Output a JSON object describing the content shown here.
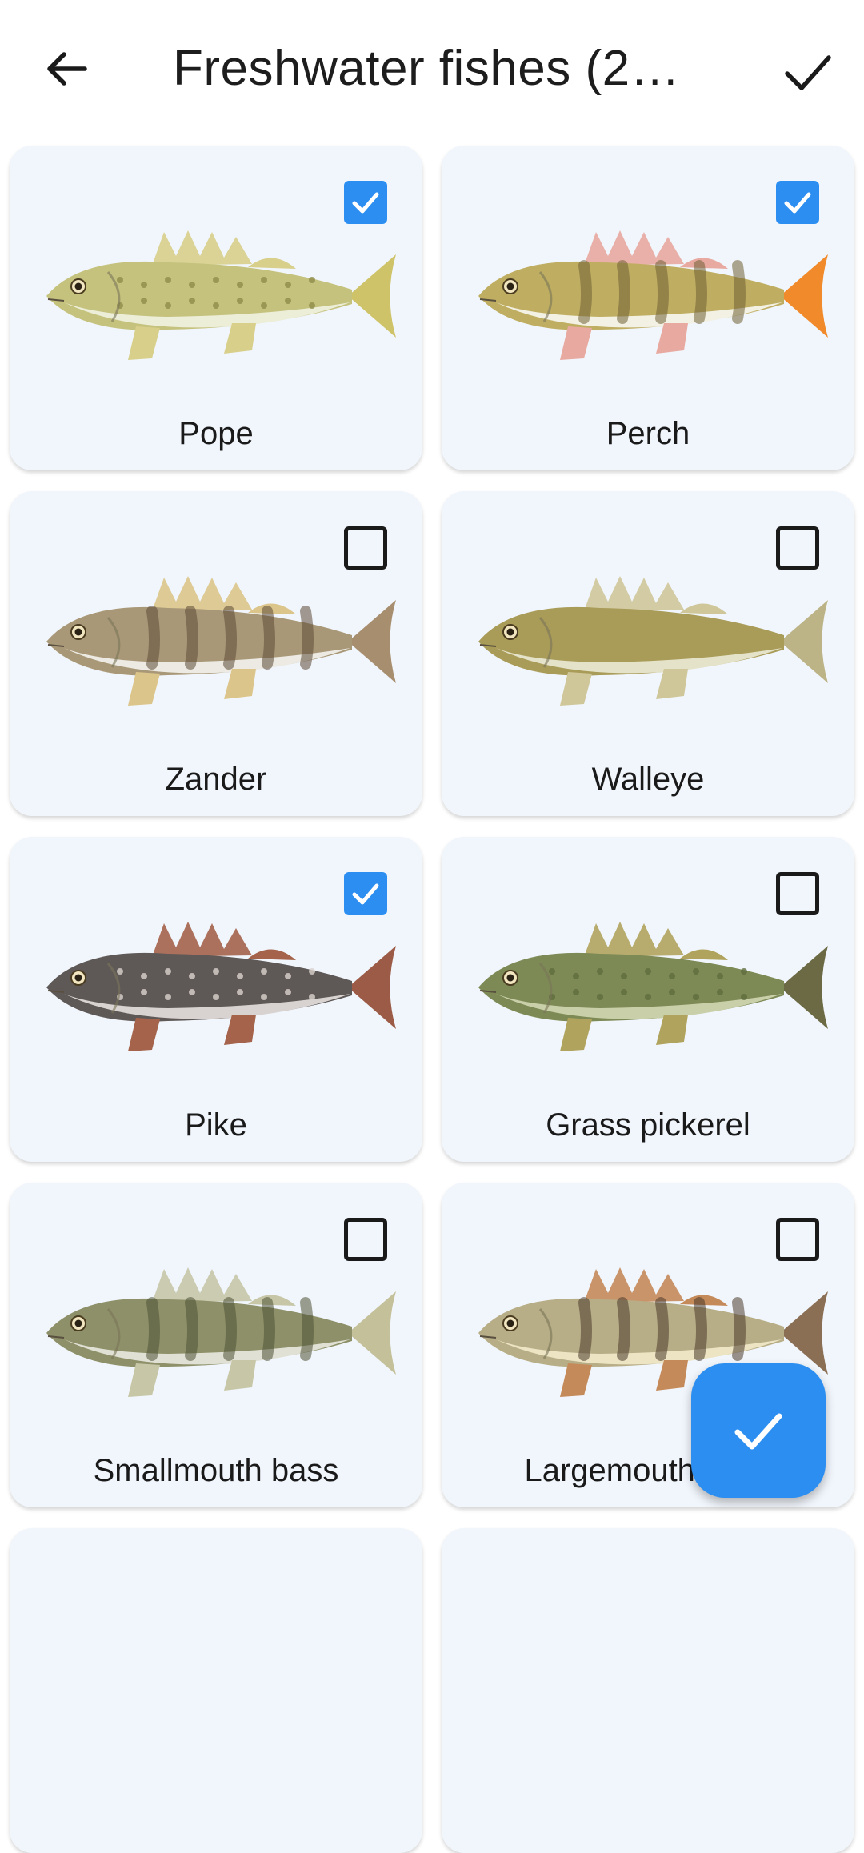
{
  "app_bar": {
    "back_icon": "arrow-back-icon",
    "title": "Freshwater fishes (2…",
    "confirm_icon": "check-icon"
  },
  "fishes": [
    {
      "name": "Pope",
      "checked": true,
      "icon": "pope-fish-image"
    },
    {
      "name": "Perch",
      "checked": true,
      "icon": "perch-fish-image"
    },
    {
      "name": "Zander",
      "checked": false,
      "icon": "zander-fish-image"
    },
    {
      "name": "Walleye",
      "checked": false,
      "icon": "walleye-fish-image"
    },
    {
      "name": "Pike",
      "checked": true,
      "icon": "pike-fish-image"
    },
    {
      "name": "Grass pickerel",
      "checked": false,
      "icon": "grass-pickerel-fish-image"
    },
    {
      "name": "Smallmouth bass",
      "checked": false,
      "icon": "smallmouth-bass-fish-image"
    },
    {
      "name": "Largemouth bass",
      "checked": false,
      "icon": "largemouth-bass-fish-image"
    }
  ],
  "fab": {
    "icon": "check-icon"
  },
  "colors": {
    "accent": "#2b8ef0",
    "card_bg": "#f1f6fc",
    "text": "#1a1a1a"
  }
}
